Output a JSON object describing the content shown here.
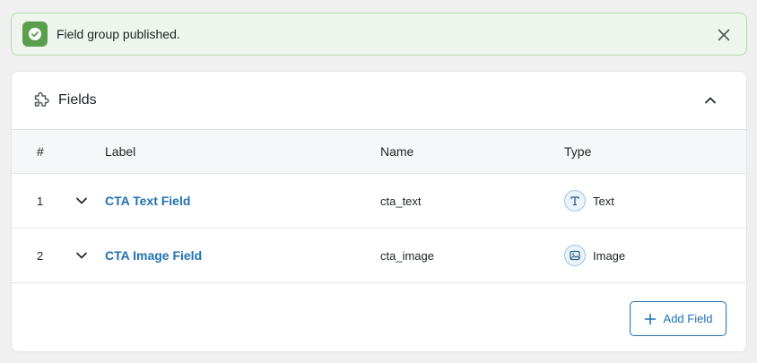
{
  "notice": {
    "message": "Field group published.",
    "status_color": "#5b9e4d"
  },
  "panel": {
    "title": "Fields",
    "icons": {
      "header": "puzzle-icon",
      "collapse": "chevron-up-icon"
    }
  },
  "table": {
    "columns": {
      "num": "#",
      "label": "Label",
      "name": "Name",
      "type": "Type"
    },
    "rows": [
      {
        "num": "1",
        "label": "CTA Text Field",
        "name": "cta_text",
        "type": "Text",
        "type_icon": "text-type-icon"
      },
      {
        "num": "2",
        "label": "CTA Image Field",
        "name": "cta_image",
        "type": "Image",
        "type_icon": "image-type-icon"
      }
    ]
  },
  "actions": {
    "add_field": "Add Field"
  },
  "colors": {
    "accent": "#2271b1",
    "success": "#5b9e4d"
  }
}
